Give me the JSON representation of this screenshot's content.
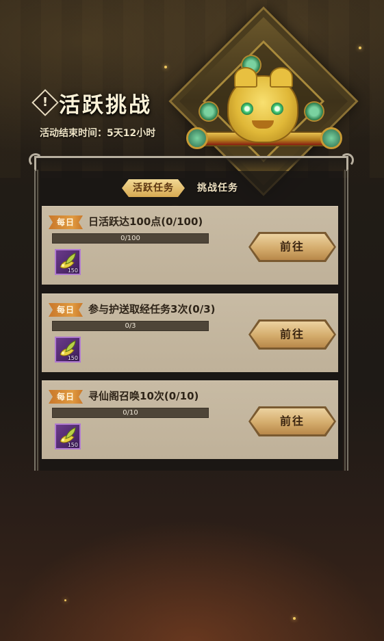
{
  "event": {
    "title": "活跃挑战",
    "title_mark": "!",
    "end_time": "活动结束时间：5天12小时"
  },
  "tabs": [
    {
      "label": "活跃任务",
      "active": true
    },
    {
      "label": "挑战任务",
      "active": false
    }
  ],
  "tasks": [
    {
      "tag": "每日",
      "title": "日活跃达100点(0/100)",
      "progress_text": "0/100",
      "progress": 0,
      "reward": {
        "icon": "golden-leaf-item-icon",
        "qty": "150"
      },
      "button": "前往"
    },
    {
      "tag": "每日",
      "title": "参与护送取经任务3次(0/3)",
      "progress_text": "0/3",
      "progress": 0,
      "reward": {
        "icon": "golden-leaf-item-icon",
        "qty": "150"
      },
      "button": "前往"
    },
    {
      "tag": "每日",
      "title": "寻仙阁召唤10次(0/10)",
      "progress_text": "0/10",
      "progress": 0,
      "reward": {
        "icon": "golden-leaf-item-icon",
        "qty": "150"
      },
      "button": "前往"
    }
  ],
  "colors": {
    "accent_gold": "#d8aa52",
    "card_bg": "#c8bba4",
    "daily_tag": "#e09a40",
    "reward_frame": "#b07ad0"
  }
}
